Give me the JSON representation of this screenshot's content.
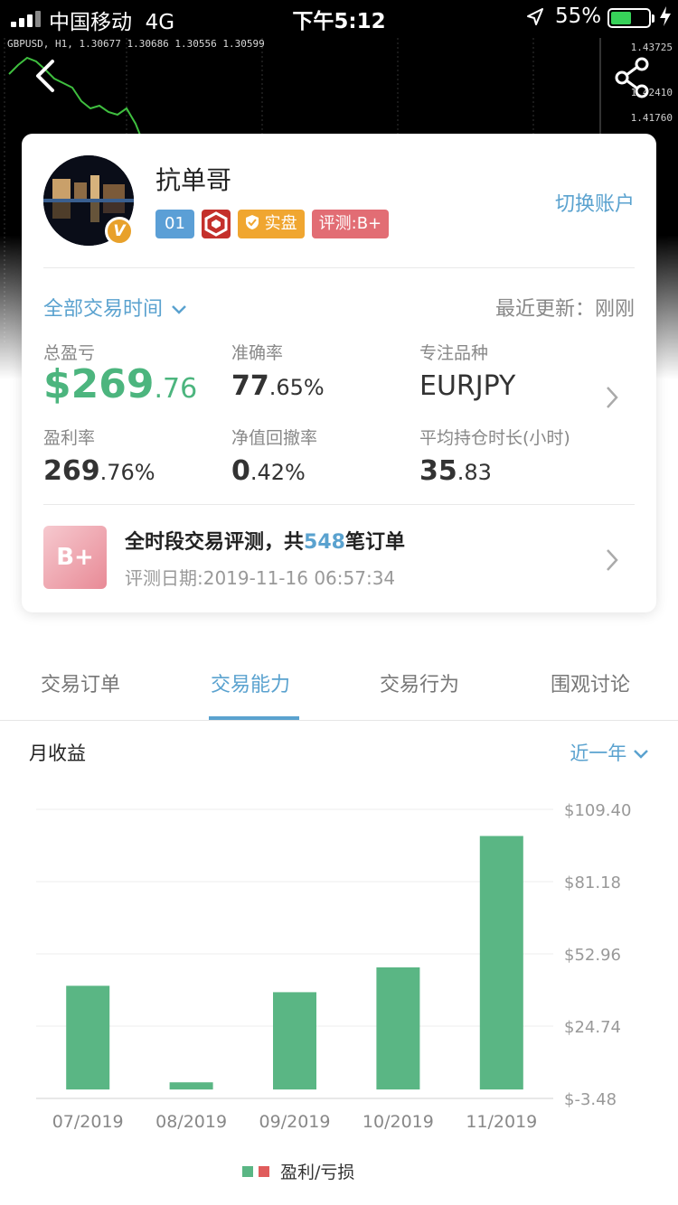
{
  "status_bar": {
    "carrier": "中国移动",
    "network": "4G",
    "time": "下午5:12",
    "battery": "55%",
    "battery_level": 0.55
  },
  "background_chart": {
    "caption": "GBPUSD, H1, 1.30677 1.30686 1.30556 1.30599",
    "prices": [
      "1.43725",
      "1.42410",
      "1.41760"
    ]
  },
  "profile": {
    "name": "抗单哥",
    "badge_letter": "V",
    "tags": {
      "number": "01",
      "real": "实盘",
      "grade": "评测:B+"
    },
    "switch_account": "切换账户"
  },
  "summary": {
    "range": "全部交易时间",
    "last_update": "最近更新：刚刚",
    "stats": {
      "total_pnl": {
        "label": "总盈亏",
        "int": "$269",
        "dec": ".76"
      },
      "accuracy": {
        "label": "准确率",
        "int": "77",
        "dec": ".65%"
      },
      "focus": {
        "label": "专注品种",
        "value": "EURJPY"
      },
      "profit_rate": {
        "label": "盈利率",
        "int": "269",
        "dec": ".76%"
      },
      "drawdown": {
        "label": "净值回撤率",
        "int": "0",
        "dec": ".42%"
      },
      "avg_hold": {
        "label": "平均持仓时长(小时)",
        "int": "35",
        "dec": ".83"
      }
    }
  },
  "evaluation": {
    "grade": "B+",
    "title_prefix": "全时段交易评测，共",
    "orders": "548",
    "title_suffix": "笔订单",
    "date": "评测日期:2019-11-16 06:57:34"
  },
  "tabs": [
    "交易订单",
    "交易能力",
    "交易行为",
    "围观讨论"
  ],
  "active_tab": 1,
  "chart_section": {
    "title": "月收益",
    "period": "近一年"
  },
  "colors": {
    "accent": "#5aa2cf",
    "profit": "#5ab684",
    "loss": "#e05c5c"
  },
  "chart_data": {
    "type": "bar",
    "categories": [
      "07/2019",
      "08/2019",
      "09/2019",
      "10/2019",
      "11/2019"
    ],
    "values": [
      40.5,
      2.8,
      38.0,
      47.7,
      99.0
    ],
    "yticks": [
      "$109.40",
      "$81.18",
      "$52.96",
      "$24.74",
      "$-3.48"
    ],
    "ylim": [
      -3.48,
      109.4
    ],
    "legend": "盈利/亏损",
    "grid": true
  }
}
